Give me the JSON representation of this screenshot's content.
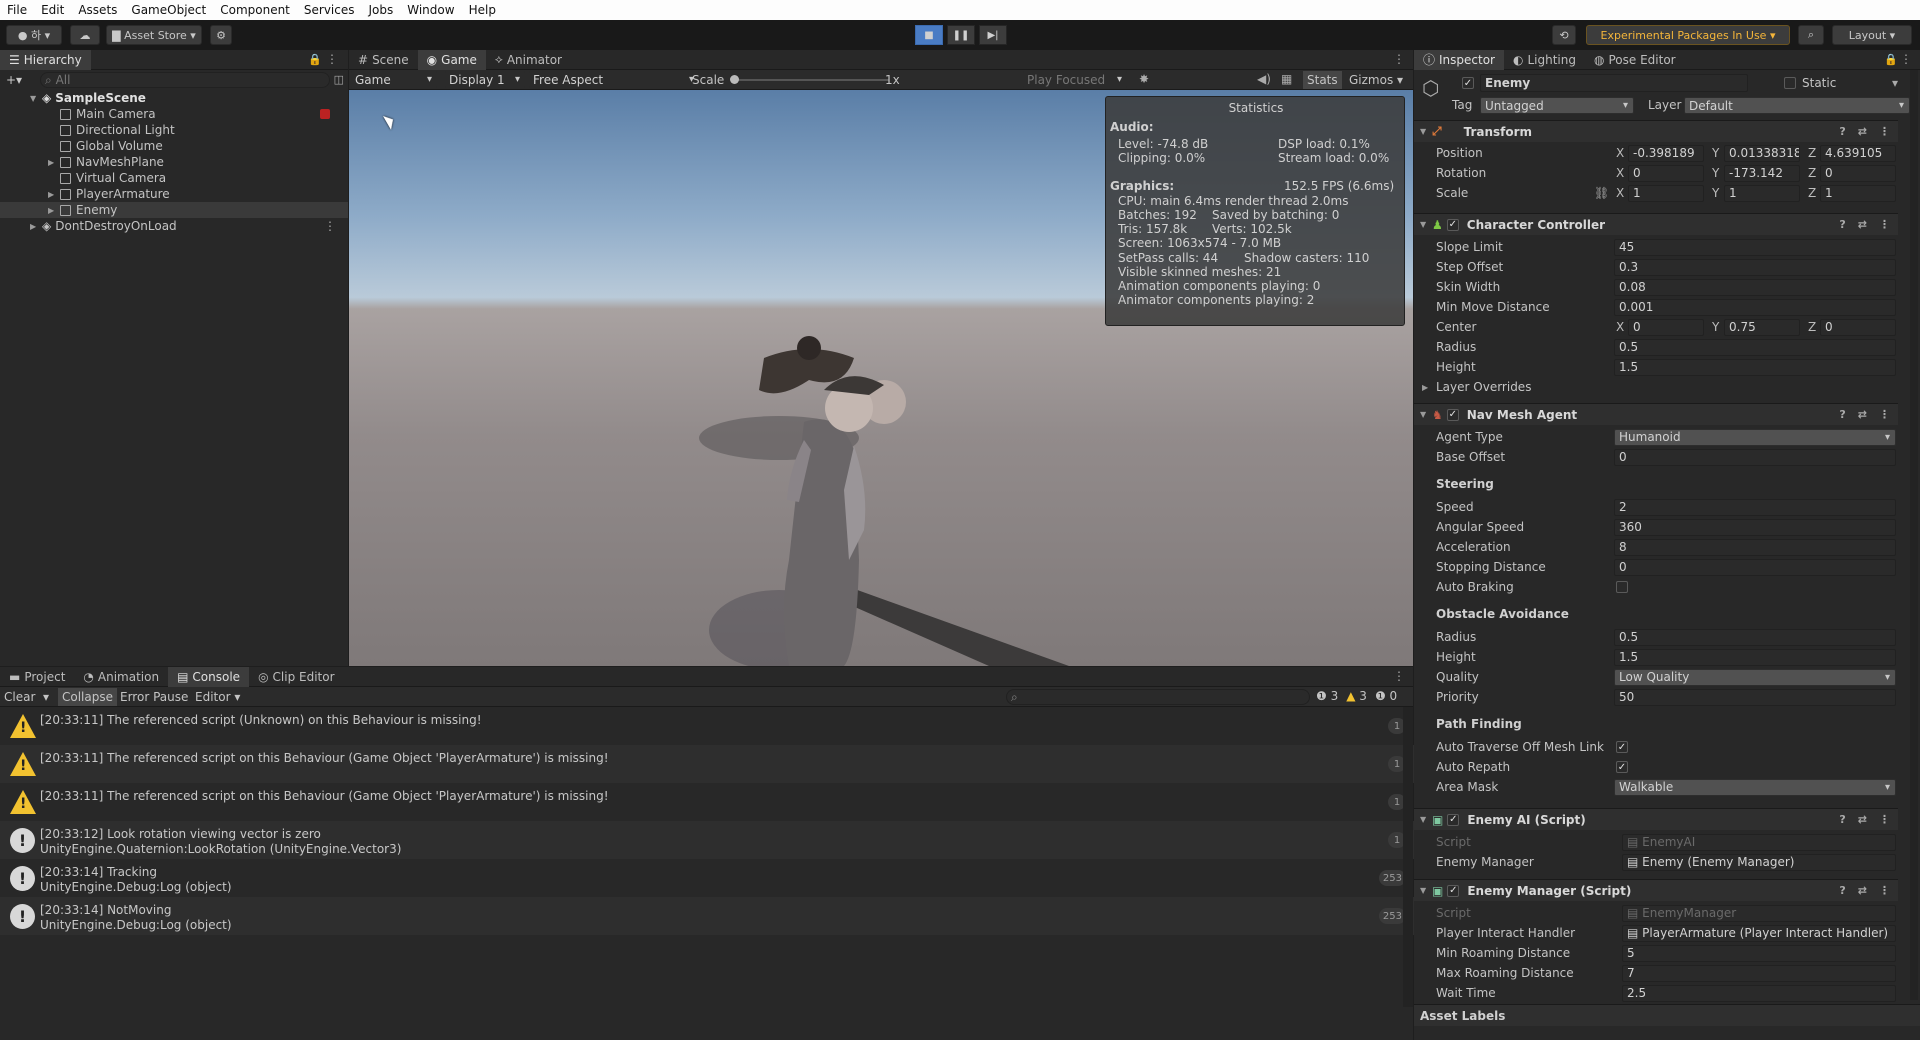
{
  "menu": [
    "File",
    "Edit",
    "Assets",
    "GameObject",
    "Component",
    "Services",
    "Jobs",
    "Window",
    "Help"
  ],
  "toolbar": {
    "account": "하",
    "asset_store": "Asset Store",
    "experimental": "Experimental Packages In Use",
    "layout": "Layout"
  },
  "hierarchy": {
    "tab": "Hierarchy",
    "search": "All",
    "scene": "SampleScene",
    "items": [
      "Main Camera",
      "Directional Light",
      "Global Volume",
      "NavMeshPlane",
      "Virtual Camera",
      "PlayerArmature",
      "Enemy"
    ],
    "dont_destroy": "DontDestroyOnLoad"
  },
  "view_tabs": [
    "Scene",
    "Game",
    "Animator"
  ],
  "game_bar": {
    "mode": "Game",
    "display": "Display 1",
    "aspect": "Free Aspect",
    "scale_label": "Scale",
    "scale_value": "1x",
    "play_focused": "Play Focused",
    "stats": "Stats",
    "gizmos": "Gizmos"
  },
  "statistics": {
    "title": "Statistics",
    "audio_heading": "Audio:",
    "level": "Level: -74.8 dB",
    "clipping": "Clipping: 0.0%",
    "dsp": "DSP load: 0.1%",
    "stream": "Stream load: 0.0%",
    "graphics_heading": "Graphics:",
    "fps": "152.5 FPS (6.6ms)",
    "cpu": "CPU: main 6.4ms  render thread 2.0ms",
    "batches": "Batches: 192",
    "saved": "Saved by batching: 0",
    "tris": "Tris: 157.8k",
    "verts": "Verts: 102.5k",
    "screen": "Screen: 1063x574 - 7.0 MB",
    "setpass": "SetPass calls: 44",
    "shadow": "Shadow casters: 110",
    "skinned": "Visible skinned meshes: 21",
    "anim": "Animation components playing: 0",
    "animator": "Animator components playing: 2"
  },
  "bottom_tabs": [
    "Project",
    "Animation",
    "Console",
    "Clip Editor"
  ],
  "console": {
    "clear": "Clear",
    "collapse": "Collapse",
    "error_pause": "Error Pause",
    "editor": "Editor",
    "count_info": "3",
    "count_warn": "3",
    "count_err": "0",
    "logs": [
      {
        "type": "warn",
        "line1": "[20:33:11] The referenced script (Unknown) on this Behaviour is missing!",
        "line2": "",
        "count": "1"
      },
      {
        "type": "warn",
        "line1": "[20:33:11] The referenced script on this Behaviour (Game Object 'PlayerArmature') is missing!",
        "line2": "",
        "count": "1"
      },
      {
        "type": "warn",
        "line1": "[20:33:11] The referenced script on this Behaviour (Game Object 'PlayerArmature') is missing!",
        "line2": "",
        "count": "1"
      },
      {
        "type": "info",
        "line1": "[20:33:12] Look rotation viewing vector is zero",
        "line2": "UnityEngine.Quaternion:LookRotation (UnityEngine.Vector3)",
        "count": "1"
      },
      {
        "type": "info",
        "line1": "[20:33:14] Tracking",
        "line2": "UnityEngine.Debug:Log (object)",
        "count": "253"
      },
      {
        "type": "info",
        "line1": "[20:33:14] NotMoving",
        "line2": "UnityEngine.Debug:Log (object)",
        "count": "253"
      }
    ]
  },
  "inspector_tabs": [
    "Inspector",
    "Lighting",
    "Pose Editor"
  ],
  "inspector": {
    "name": "Enemy",
    "static": "Static",
    "tag_label": "Tag",
    "tag": "Untagged",
    "layer_label": "Layer",
    "layer": "Default",
    "transform": {
      "title": "Transform",
      "position": "Position",
      "rotation": "Rotation",
      "scale": "Scale",
      "pos": [
        "-0.398189",
        "0.01338318",
        "4.639105"
      ],
      "rot": [
        "0",
        "-173.142",
        "0"
      ],
      "scl": [
        "1",
        "1",
        "1"
      ]
    },
    "cc": {
      "title": "Character Controller",
      "rows": [
        [
          "Slope Limit",
          "45"
        ],
        [
          "Step Offset",
          "0.3"
        ],
        [
          "Skin Width",
          "0.08"
        ],
        [
          "Min Move Distance",
          "0.001"
        ]
      ],
      "center": "Center",
      "center_vals": [
        "0",
        "0.75",
        "0"
      ],
      "radius": [
        "Radius",
        "0.5"
      ],
      "height": [
        "Height",
        "1.5"
      ],
      "layer_overrides": "Layer Overrides"
    },
    "nav": {
      "title": "Nav Mesh Agent",
      "agent_type": [
        "Agent Type",
        "Humanoid"
      ],
      "base_offset": [
        "Base Offset",
        "0"
      ],
      "steering": "Steering",
      "steer_rows": [
        [
          "Speed",
          "2"
        ],
        [
          "Angular Speed",
          "360"
        ],
        [
          "Acceleration",
          "8"
        ],
        [
          "Stopping Distance",
          "0"
        ]
      ],
      "auto_braking": "Auto Braking",
      "obstacle": "Obstacle Avoidance",
      "obs_radius": [
        "Radius",
        "0.5"
      ],
      "obs_height": [
        "Height",
        "1.5"
      ],
      "quality": [
        "Quality",
        "Low Quality"
      ],
      "priority": [
        "Priority",
        "50"
      ],
      "path": "Path Finding",
      "auto_traverse": "Auto Traverse Off Mesh Link",
      "auto_repath": "Auto Repath",
      "area_mask": [
        "Area Mask",
        "Walkable"
      ]
    },
    "ai": {
      "title": "Enemy AI (Script)",
      "script_label": "Script",
      "script": "EnemyAI",
      "mgr_label": "Enemy Manager",
      "mgr": "Enemy (Enemy Manager)"
    },
    "em": {
      "title": "Enemy Manager (Script)",
      "script_label": "Script",
      "script": "EnemyManager",
      "pih_label": "Player Interact Handler",
      "pih": "PlayerArmature (Player Interact Handler)",
      "rows": [
        [
          "Min Roaming Distance",
          "5"
        ],
        [
          "Max Roaming Distance",
          "7"
        ],
        [
          "Wait Time",
          "2.5"
        ]
      ]
    },
    "asset_labels": "Asset Labels"
  }
}
